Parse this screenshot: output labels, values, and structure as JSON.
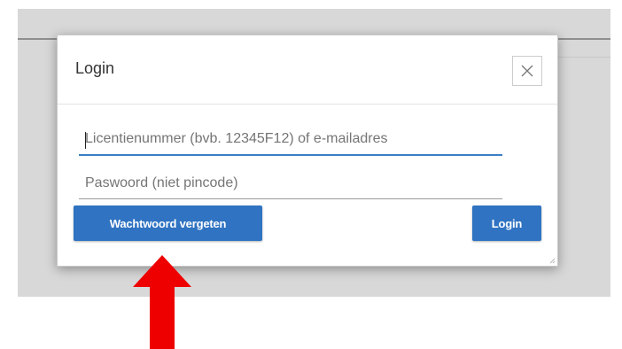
{
  "dialog": {
    "title": "Login",
    "close_icon": "close-icon"
  },
  "form": {
    "license_placeholder": "Licentienummer (bvb. 12345F12) of e-mailadres",
    "license_value": "",
    "password_placeholder": "Paswoord (niet pincode)",
    "password_value": ""
  },
  "buttons": {
    "forgot_label": "Wachtwoord vergeten",
    "login_label": "Login"
  },
  "annotation": {
    "arrow_icon": "arrow-up-icon",
    "arrow_color": "#ee0000"
  },
  "colors": {
    "primary": "#2f73c2",
    "focus_underline": "#3b7fc4",
    "backdrop": "#d8d8d8"
  }
}
